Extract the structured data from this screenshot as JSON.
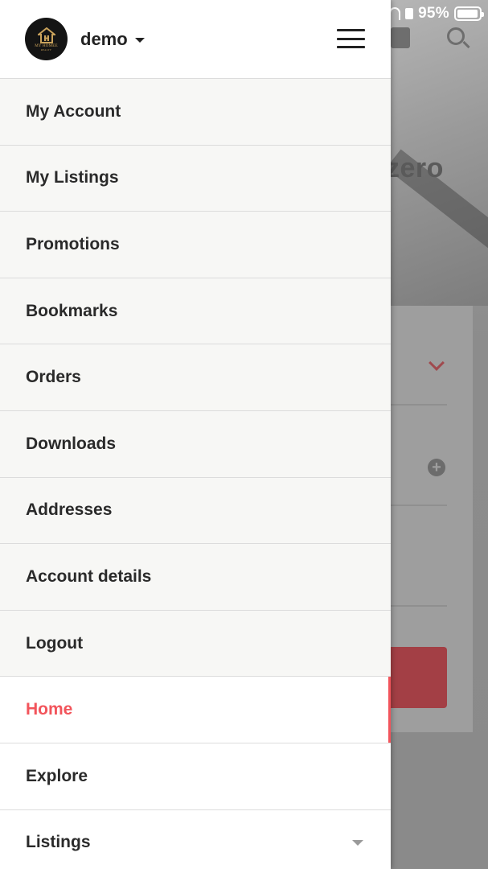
{
  "status_bar": {
    "battery_percent_text": "95%",
    "battery_level": 0.95
  },
  "background_page": {
    "hero_title_fragment": "zero"
  },
  "drawer": {
    "avatar_brand_text": "MY HOMEE",
    "avatar_brand_subtext": "REALTY",
    "user": {
      "name": "demo"
    },
    "account_menu": [
      {
        "label": "My Account"
      },
      {
        "label": "My Listings"
      },
      {
        "label": "Promotions"
      },
      {
        "label": "Bookmarks"
      },
      {
        "label": "Orders"
      },
      {
        "label": "Downloads"
      },
      {
        "label": "Addresses"
      },
      {
        "label": "Account details"
      },
      {
        "label": "Logout"
      }
    ],
    "nav_menu": [
      {
        "label": "Home",
        "active": true
      },
      {
        "label": "Explore"
      },
      {
        "label": "Listings",
        "has_submenu": true
      }
    ]
  },
  "colors": {
    "accent": "#f2545b",
    "text": "#2a2a2a",
    "account_bg": "#f7f7f5",
    "overlay_button": "#a33f45"
  },
  "icons": {
    "menu": "hamburger-icon",
    "user_dropdown": "caret-down-icon",
    "submenu": "caret-down-icon",
    "avatar": "house-logo-icon"
  }
}
